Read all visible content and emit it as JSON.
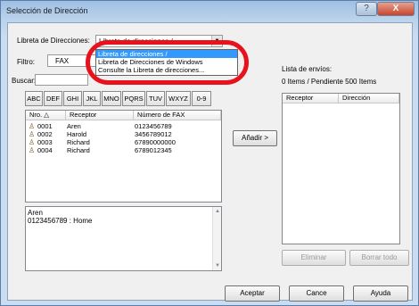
{
  "window": {
    "title": "Selección de Dirección",
    "help_glyph": "?",
    "close_glyph": "X"
  },
  "filters": {
    "libreta_label": "Libreta de Direcciones:",
    "libreta_value": "Libreta de direcciones /",
    "filtro_label": "Filtro:",
    "filtro_value": "FAX",
    "buscar_label": "Buscar:",
    "buscar_value": ""
  },
  "dropdown_options": [
    "Libreta de direcciones /",
    "Libreta de Direcciones de Windows",
    "Consulte la Libreta de direcciones..."
  ],
  "alpha_buttons": [
    "ABC",
    "DEF",
    "GHI",
    "JKL",
    "MNO",
    "PQRS",
    "TUV",
    "WXYZ",
    "0-9"
  ],
  "address_table": {
    "columns": [
      "Nro. △",
      "Receptor",
      "Número de FAX"
    ],
    "rows": [
      {
        "nro": "0001",
        "receptor": "Aren",
        "fax": "0123456789"
      },
      {
        "nro": "0002",
        "receptor": "Harold",
        "fax": "3456789012"
      },
      {
        "nro": "0003",
        "receptor": "Richard",
        "fax": "67890000000"
      },
      {
        "nro": "0004",
        "receptor": "Richard",
        "fax": "6789012345"
      }
    ]
  },
  "details": {
    "line1": "Aren",
    "line2": "0123456789 : Home"
  },
  "add_button": "Añadir >",
  "send_list": {
    "label": "Lista de envíos:",
    "status": "0 Items / Pendiente 500 Items",
    "columns": [
      "Receptor",
      "Dirección"
    ]
  },
  "buttons": {
    "eliminar": "Eliminar",
    "borrar_todo": "Borrar todo",
    "aceptar": "Aceptar",
    "cancelar": "Cance",
    "ayuda": "Ayuda"
  }
}
